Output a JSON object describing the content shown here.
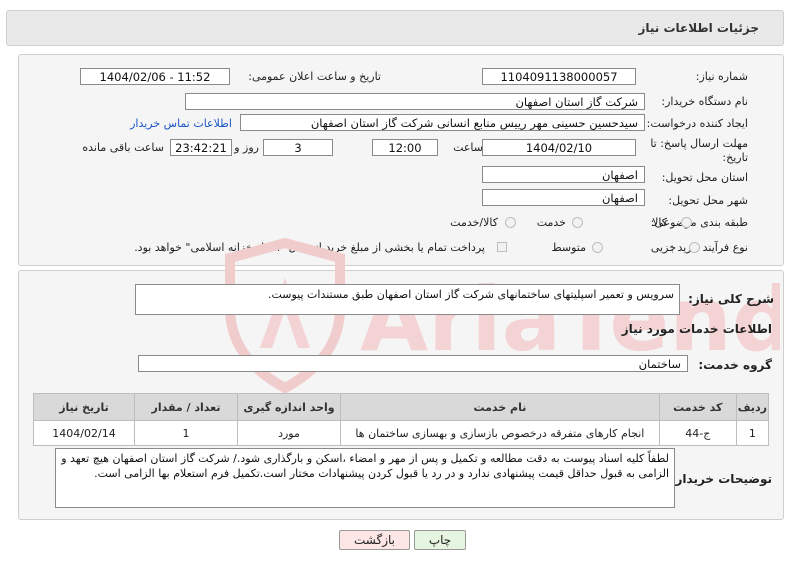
{
  "header": {
    "title": "جزئیات اطلاعات نیاز"
  },
  "form": {
    "need_number_label": "شماره نیاز:",
    "need_number": "1104091138000057",
    "announce_label": "تاریخ و ساعت اعلان عمومی:",
    "announce_value": "1404/02/06 - 11:52",
    "buyer_org_label": "نام دستگاه خریدار:",
    "buyer_org": "شرکت گاز استان اصفهان",
    "requester_label": "ایجاد کننده درخواست:",
    "requester": "سیدحسین حسینی مهر رییس منابع انسانی شرکت گاز استان اصفهان",
    "contact_link": "اطلاعات تماس خریدار",
    "deadline_label_1": "مهلت ارسال پاسخ: تا",
    "deadline_label_2": "تاریخ:",
    "deadline_date": "1404/02/10",
    "time_label": "ساعت",
    "deadline_time": "12:00",
    "days_value": "3",
    "days_label": "روز و",
    "remaining_time": "23:42:21",
    "remaining_label": "ساعت باقی مانده",
    "province_label": "استان محل تحویل:",
    "province": "اصفهان",
    "city_label": "شهر محل تحویل:",
    "city": "اصفهان",
    "category_label": "طبقه بندی موضوعی:",
    "category_options": [
      "کالا",
      "خدمت",
      "کالا/خدمت"
    ],
    "process_label": "نوع فرآیند خرید :",
    "process_options": [
      "جزیی",
      "متوسط"
    ],
    "payment_note": "پرداخت تمام یا بخشی از مبلغ خرید،از محل \"اسناد خزانه اسلامی\" خواهد بود."
  },
  "summary": {
    "label": "شرح کلی نیاز:",
    "text": "سرویس و تعمیر اسپلیتهای ساختمانهای شرکت گاز استان اصفهان طبق مستندات پیوست."
  },
  "services": {
    "section_title": "اطلاعات خدمات مورد نیاز",
    "group_label": "گروه خدمت:",
    "group_value": "ساختمان",
    "columns": [
      "ردیف",
      "کد خدمت",
      "نام خدمت",
      "واحد اندازه گیری",
      "تعداد / مقدار",
      "تاریخ نیاز"
    ],
    "rows": [
      [
        "1",
        "ج-44",
        "انجام کارهای متفرقه درخصوص بازسازی و بهسازی ساختمان ها",
        "مورد",
        "1",
        "1404/02/14"
      ]
    ]
  },
  "buyer_notes": {
    "label": "توضیحات خریدار:",
    "text": "لطفاً کلیه اسناد پیوست به دقت مطالعه و تکمیل و  پس از مهر و امضاء ،اسکن و بارگذاری شود./  شرکت گاز  استان اصفهان هیچ تعهد و الزامی به قبول حداقل قیمت پیشنهادی ندارد و در رد یا قبول کردن پیشنهادات مختار است.تکمیل فرم استعلام بها الزامی است."
  },
  "buttons": {
    "print": "چاپ",
    "back": "بازگشت"
  },
  "watermark": {
    "text": "AriaTender.neT"
  },
  "colors": {
    "link": "#1a55c8",
    "print_bg": "#e6f5e0",
    "back_bg": "#fde6e6",
    "watermark": "#f3d3d3"
  }
}
